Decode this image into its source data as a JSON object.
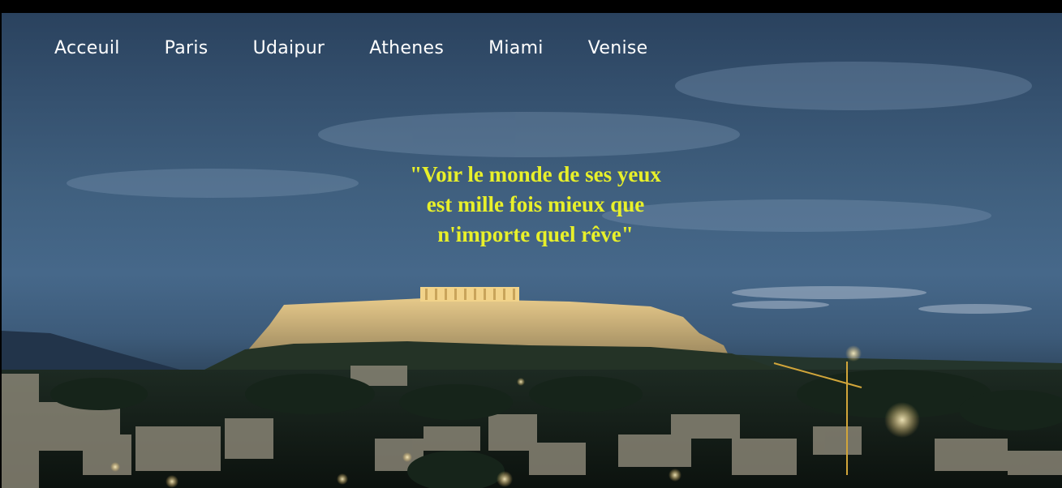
{
  "nav": {
    "items": [
      {
        "label": "Acceuil"
      },
      {
        "label": "Paris"
      },
      {
        "label": "Udaipur"
      },
      {
        "label": "Athenes"
      },
      {
        "label": "Miami"
      },
      {
        "label": "Venise"
      }
    ]
  },
  "hero": {
    "quote": "\"Voir le monde de ses yeux est mille fois mieux que n'importe quel rêve\"",
    "quote_color": "#e8f02a",
    "background_scene": "acropolis-athens-at-dusk"
  }
}
